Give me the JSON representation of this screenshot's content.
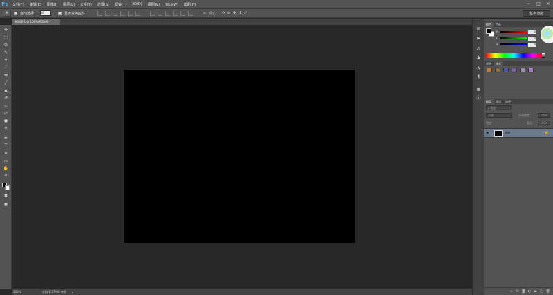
{
  "app": {
    "logo": "Ps"
  },
  "menu": [
    "文件(F)",
    "编辑(E)",
    "图像(I)",
    "图层(L)",
    "文字(Y)",
    "选择(S)",
    "滤镜(T)",
    "3D(D)",
    "视图(V)",
    "窗口(W)",
    "帮助(H)"
  ],
  "window_controls": {
    "minimize": "–",
    "maximize": "□",
    "close": "✕"
  },
  "options": {
    "auto_select_label": "自动选择：",
    "auto_select_value": "组",
    "show_transform_label": "显示变换控件",
    "mode_3d_label": "3D 模式："
  },
  "workspace": {
    "label": "基本功能"
  },
  "document": {
    "tab_label": "未标题-1 @ 100%(RGB/8) *"
  },
  "status": {
    "zoom": "100%",
    "doc_info": "文档:1.37M/0 字节",
    "arrow": "▸"
  },
  "color_panel": {
    "tabs": [
      "颜色",
      "色板"
    ],
    "sliders": [
      {
        "label": "R",
        "value": "0",
        "gradient": "linear-gradient(to right,#000,#ff0000)"
      },
      {
        "label": "G",
        "value": "0",
        "gradient": "linear-gradient(to right,#000,#00ff00)"
      },
      {
        "label": "B",
        "value": "0",
        "gradient": "linear-gradient(to right,#000,#0000ff)"
      }
    ]
  },
  "adjust_panel": {
    "tabs": [
      "调整",
      "样式"
    ],
    "swatches": [
      "#c87a2a",
      "#8a6a3a",
      "#4a56b8",
      "#7a5aa8",
      "#9a8ab8",
      "#b07ad0"
    ]
  },
  "layers_panel": {
    "tabs": [
      "图层",
      "通道",
      "路径"
    ],
    "kind_label": "ρ 类型",
    "blend_mode": "正常",
    "opacity_label": "不透明度：",
    "opacity_value": "100%",
    "lock_label": "锁定：",
    "fill_label": "填充：",
    "fill_value": "100%",
    "layer_name": "背景"
  },
  "colors": {
    "accent": "#3fa9f5",
    "layer_selected": "#6a7a8c",
    "ui_bg": "#535353",
    "canvas": "#000000",
    "pasteboard": "#282828"
  }
}
